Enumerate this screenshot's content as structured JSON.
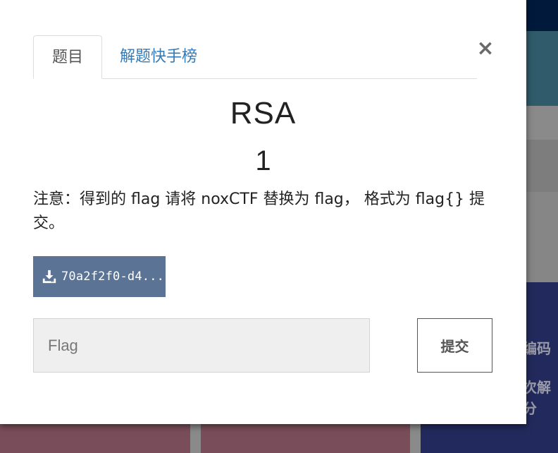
{
  "modal": {
    "tabs": [
      {
        "label": "题目",
        "active": true
      },
      {
        "label": "解题快手榜",
        "active": false
      }
    ],
    "close_label": "×",
    "challenge": {
      "title": "RSA",
      "points": "1",
      "description": "注意：得到的 flag 请将 noxCTF 替换为 flag， 格式为 flag{} 提交。"
    },
    "download": {
      "label": "70a2f2f0-d4...",
      "icon": "download-icon"
    },
    "flag_input": {
      "placeholder": "Flag",
      "value": ""
    },
    "submit_label": "提交"
  },
  "background": {
    "fragments": [
      "编码",
      "次解",
      "分"
    ]
  },
  "colors": {
    "tab_link": "#337ab7",
    "download_button": "#5b7394",
    "input_bg": "#efefef",
    "backdrop_navy": "#222a5d",
    "backdrop_card": "#7a4d5a"
  }
}
